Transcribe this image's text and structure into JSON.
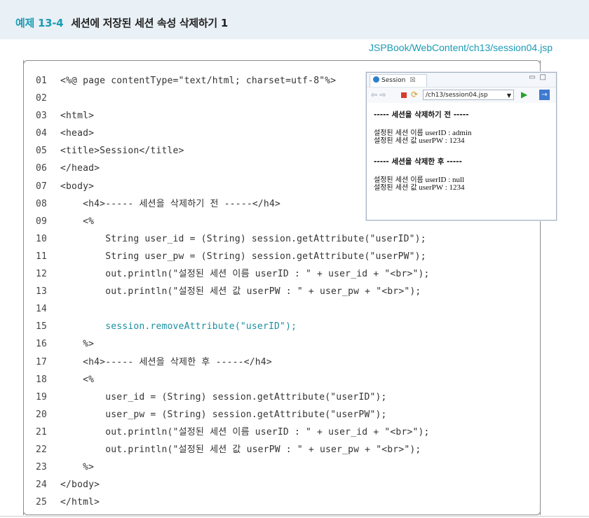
{
  "header": {
    "label": "예제",
    "number": "13-4",
    "title": "세션에 저장된 세션 속성 삭제하기 1",
    "file_path": "JSPBook/WebContent/ch13/session04.jsp"
  },
  "code_lines": [
    {
      "n": "01",
      "t": "<%@ page contentType=\"text/html; charset=utf-8\"%>"
    },
    {
      "n": "02",
      "t": ""
    },
    {
      "n": "03",
      "t": "<html>"
    },
    {
      "n": "04",
      "t": "<head>"
    },
    {
      "n": "05",
      "t": "<title>Session</title>"
    },
    {
      "n": "06",
      "t": "</head>"
    },
    {
      "n": "07",
      "t": "<body>"
    },
    {
      "n": "08",
      "t": "    <h4>----- 세션을 삭제하기 전 -----</h4>"
    },
    {
      "n": "09",
      "t": "    <%"
    },
    {
      "n": "10",
      "t": "        String user_id = (String) session.getAttribute(\"userID\");"
    },
    {
      "n": "11",
      "t": "        String user_pw = (String) session.getAttribute(\"userPW\");"
    },
    {
      "n": "12",
      "t": "        out.println(\"설정된 세션 이름 userID : \" + user_id + \"<br>\");"
    },
    {
      "n": "13",
      "t": "        out.println(\"설정된 세션 값 userPW : \" + user_pw + \"<br>\");"
    },
    {
      "n": "14",
      "t": ""
    },
    {
      "n": "15",
      "t": "        session.removeAttribute(\"userID\");",
      "hl": true
    },
    {
      "n": "16",
      "t": "    %>"
    },
    {
      "n": "17",
      "t": "    <h4>----- 세션을 삭제한 후 -----</h4>"
    },
    {
      "n": "18",
      "t": "    <%"
    },
    {
      "n": "19",
      "t": "        user_id = (String) session.getAttribute(\"userID\");"
    },
    {
      "n": "20",
      "t": "        user_pw = (String) session.getAttribute(\"userPW\");"
    },
    {
      "n": "21",
      "t": "        out.println(\"설정된 세션 이름 userID : \" + user_id + \"<br>\");"
    },
    {
      "n": "22",
      "t": "        out.println(\"설정된 세션 값 userPW : \" + user_pw + \"<br>\");"
    },
    {
      "n": "23",
      "t": "    %>"
    },
    {
      "n": "24",
      "t": "</body>"
    },
    {
      "n": "25",
      "t": "</html>"
    }
  ],
  "browser": {
    "tab_title": "Session",
    "tab_close": "☒",
    "url": "/ch13/session04.jsp",
    "heading_before": "----- 세션을 삭제하기 전 -----",
    "before_id_label": "설정된 세션 이름",
    "before_id_value": "userID : admin",
    "before_pw_label": "설정된 세션 값",
    "before_pw_value": "userPW : 1234",
    "heading_after": "----- 세션을 삭제한 후 -----",
    "after_id_label": "설정된 세션 이름",
    "after_id_value": "userID : null",
    "after_pw_label": "설정된 세션 값",
    "after_pw_value": "userPW : 1234"
  }
}
